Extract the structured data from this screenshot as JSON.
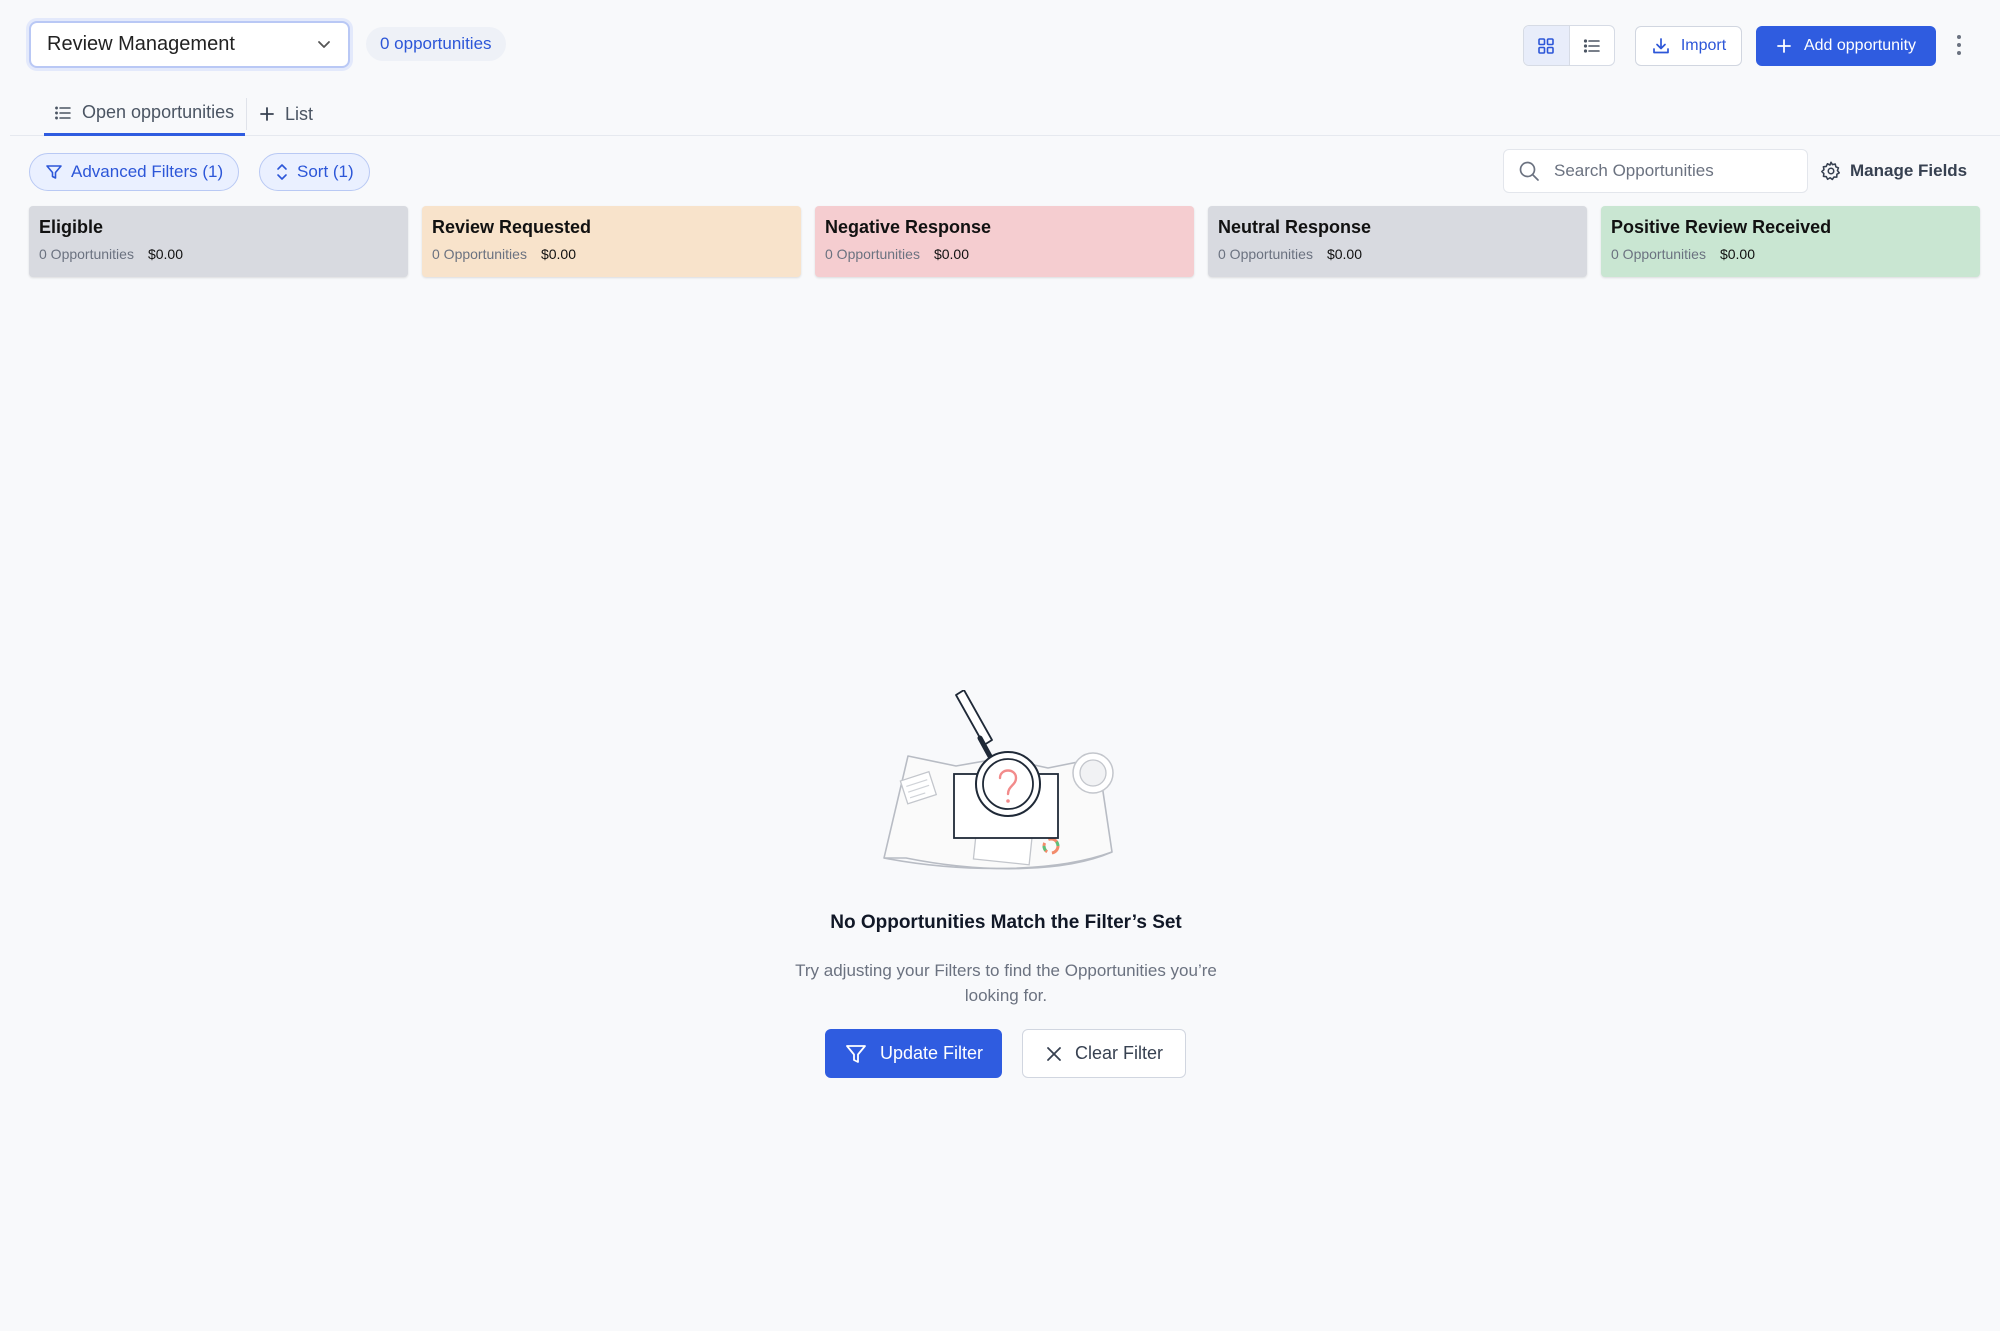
{
  "header": {
    "pipeline_name": "Review Management",
    "opportunity_count": "0 opportunities",
    "import_label": "Import",
    "add_label": "Add opportunity"
  },
  "tabs": [
    {
      "label": "Open opportunities",
      "icon": "list-icon",
      "active": true
    },
    {
      "label": "List",
      "icon": "plus-icon",
      "active": false
    }
  ],
  "filters": {
    "advanced_label": "Advanced Filters (1)",
    "sort_label": "Sort (1)",
    "search_placeholder": "Search Opportunities",
    "manage_fields_label": "Manage Fields"
  },
  "stages": [
    {
      "name": "Eligible",
      "count": "0 Opportunities",
      "amount": "$0.00",
      "color": "#d8dae0"
    },
    {
      "name": "Review Requested",
      "count": "0 Opportunities",
      "amount": "$0.00",
      "color": "#f8e3cb"
    },
    {
      "name": "Negative Response",
      "count": "0 Opportunities",
      "amount": "$0.00",
      "color": "#f5cdd0"
    },
    {
      "name": "Neutral Response",
      "count": "0 Opportunities",
      "amount": "$0.00",
      "color": "#d8dae0"
    },
    {
      "name": "Positive Review Received",
      "count": "0 Opportunities",
      "amount": "$0.00",
      "color": "#c9e6d2"
    }
  ],
  "empty_state": {
    "title": "No Opportunities Match the Filter’s Set",
    "description": "Try adjusting your Filters to find the Opportunities you’re looking for.",
    "update_label": "Update Filter",
    "clear_label": "Clear Filter"
  },
  "colors": {
    "accent": "#2f5ce0",
    "background": "#f8f9fb"
  }
}
